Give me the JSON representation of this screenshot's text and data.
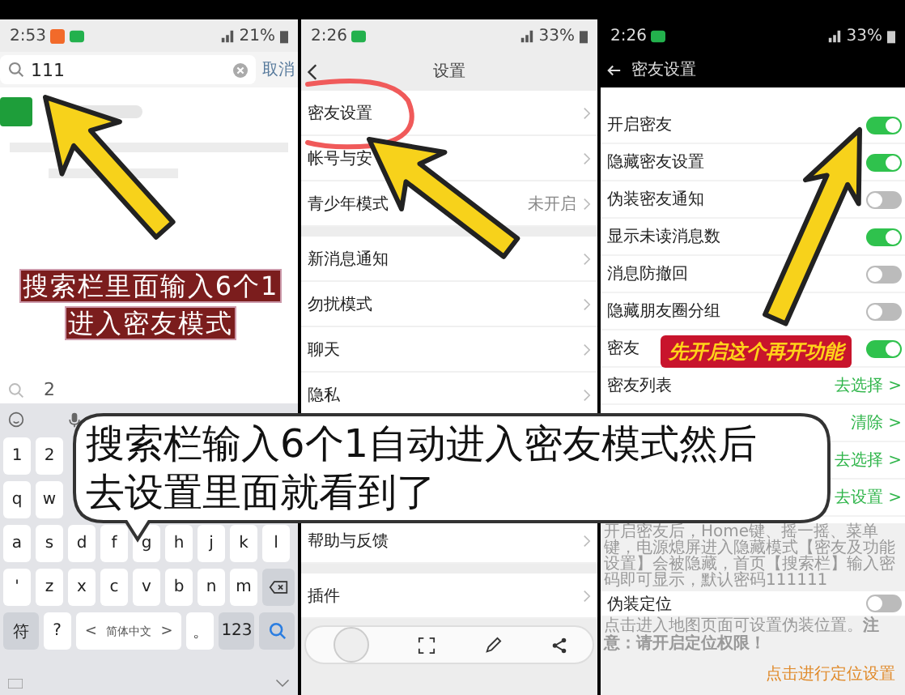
{
  "left_phone": {
    "status_bar": {
      "time": "2:53",
      "battery": "21%"
    },
    "search": {
      "value": "111",
      "cancel": "取消"
    },
    "history": [
      "2"
    ],
    "keyboard": {
      "rows": [
        [
          {
            "kind": "key",
            "label": "1"
          },
          {
            "kind": "key",
            "label": "2"
          }
        ],
        [
          {
            "kind": "key",
            "label": "q"
          },
          {
            "kind": "key",
            "label": "w"
          }
        ],
        [
          {
            "kind": "key",
            "label": "a"
          },
          {
            "kind": "key",
            "label": "s"
          },
          {
            "kind": "key",
            "label": "d"
          },
          {
            "kind": "key",
            "label": "f"
          },
          {
            "kind": "key",
            "label": "g"
          },
          {
            "kind": "key",
            "label": "h"
          },
          {
            "kind": "key",
            "label": "j"
          },
          {
            "kind": "key",
            "label": "k"
          },
          {
            "kind": "key",
            "label": "l"
          }
        ],
        [
          {
            "kind": "key",
            "label": "'"
          },
          {
            "kind": "key",
            "label": "z"
          },
          {
            "kind": "key",
            "label": "x"
          },
          {
            "kind": "key",
            "label": "c"
          },
          {
            "kind": "key",
            "label": "v"
          },
          {
            "kind": "key",
            "label": "b"
          },
          {
            "kind": "key",
            "label": "n"
          },
          {
            "kind": "key",
            "label": "m"
          },
          {
            "kind": "backspace"
          }
        ]
      ],
      "bottom_row": [
        {
          "kind": "fn",
          "label": "符"
        },
        {
          "kind": "key",
          "label": "?"
        },
        {
          "kind": "space",
          "label": "简体中文",
          "prev": "<",
          "next": ">"
        },
        {
          "kind": "key",
          "label": "。"
        },
        {
          "kind": "fn",
          "label": "123"
        },
        {
          "kind": "search"
        }
      ]
    }
  },
  "middle_phone": {
    "status_bar": {
      "time": "2:26",
      "battery": "33%"
    },
    "title": "设置",
    "rows": [
      {
        "kind": "row",
        "label": "密友设置"
      },
      {
        "kind": "row",
        "label": "帐号与安"
      },
      {
        "kind": "row",
        "label": "青少年模式",
        "value": "未开启"
      },
      {
        "kind": "gap"
      },
      {
        "kind": "row",
        "label": "新消息通知"
      },
      {
        "kind": "row",
        "label": "勿扰模式"
      },
      {
        "kind": "row",
        "label": "聊天"
      },
      {
        "kind": "row",
        "label": "隐私"
      },
      {
        "kind": "hidden"
      },
      {
        "kind": "row",
        "label": "帮助与反馈"
      },
      {
        "kind": "gap"
      },
      {
        "kind": "row",
        "label": "插件"
      }
    ]
  },
  "right_phone": {
    "status_bar": {
      "time": "2:26",
      "battery": "33%"
    },
    "title": "密友设置",
    "rows": [
      {
        "kind": "toggle",
        "label": "开启密友",
        "on": true
      },
      {
        "kind": "toggle",
        "label": "隐藏密友设置",
        "on": true
      },
      {
        "kind": "toggle",
        "label": "伪装密友通知",
        "on": false
      },
      {
        "kind": "toggle",
        "label": "显示未读消息数",
        "on": true
      },
      {
        "kind": "toggle",
        "label": "消息防撤回",
        "on": false
      },
      {
        "kind": "toggle",
        "label": "隐藏朋友圈分组",
        "on": false
      },
      {
        "kind": "toggle",
        "label": "密友",
        "on": true
      },
      {
        "kind": "link",
        "label": "密友列表",
        "action": "去选择 >"
      },
      {
        "kind": "link",
        "action": "清除 >"
      },
      {
        "kind": "link",
        "action": "去选择 >"
      },
      {
        "kind": "link",
        "action": "去设置 >"
      }
    ],
    "description": "开启密友后，Home键、摇一摇、菜单键，电源熄屏进入隐藏模式【密友及功能设置】会被隐藏，首页【搜索栏】输入密码即可显示，默认密码111111",
    "location": {
      "label": "伪装定位",
      "on": false,
      "note": "点击进入地图页面可设置伪装位置。**注意：请开启定位权限！**",
      "link": "点击进行定位设置"
    }
  },
  "annotations": {
    "caption_lines": [
      "搜索栏里面输入6个1",
      "进入密友模式"
    ],
    "bubble_lines": [
      "搜索栏输入6个1自动进入密友模式然后",
      "去设置里面就看到了"
    ],
    "banner": "先开启这个再开功能"
  }
}
